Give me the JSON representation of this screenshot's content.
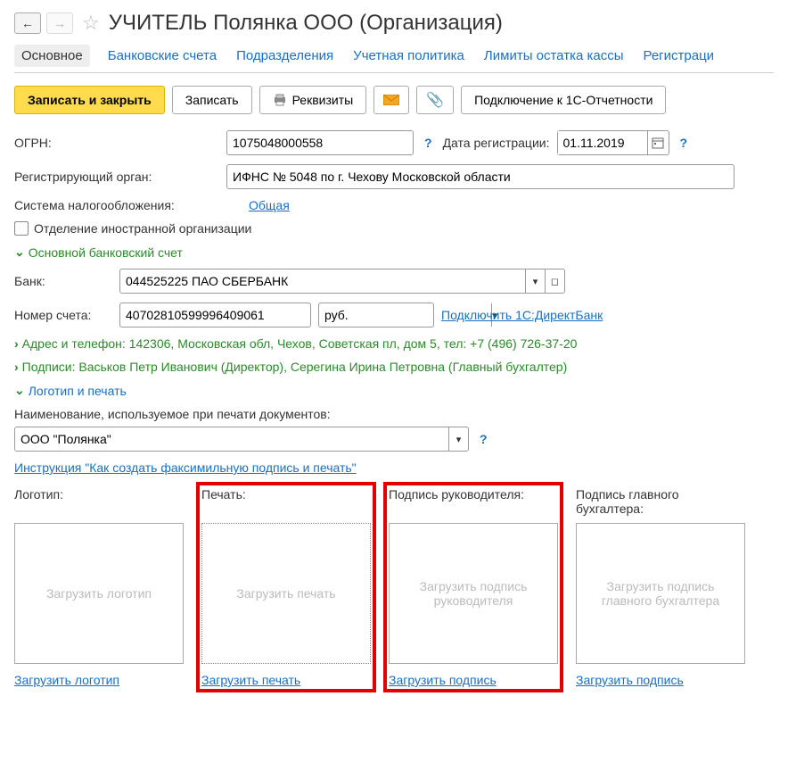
{
  "nav": {
    "back": "←",
    "forward": "→"
  },
  "title": "УЧИТЕЛЬ Полянка ООО (Организация)",
  "tabs": {
    "main": "Основное",
    "bank_accounts": "Банковские счета",
    "divisions": "Подразделения",
    "accounting_policy": "Учетная политика",
    "cash_limits": "Лимиты остатка кассы",
    "registrations": "Регистраци"
  },
  "toolbar": {
    "write_close": "Записать и закрыть",
    "write": "Записать",
    "requisites": "Реквизиты",
    "connect_reporting": "Подключение к 1С-Отчетности"
  },
  "fields": {
    "ogrn_label": "ОГРН:",
    "ogrn_value": "1075048000558",
    "reg_date_label": "Дата регистрации:",
    "reg_date_value": "01.11.2019",
    "reg_body_label": "Регистрирующий орган:",
    "reg_body_value": "ИФНС № 5048 по г. Чехову Московской области",
    "tax_system_label": "Система налогообложения:",
    "tax_system_value": "Общая",
    "foreign_branch": "Отделение иностранной организации"
  },
  "bank": {
    "header": "Основной банковский счет",
    "bank_label": "Банк:",
    "bank_value": "044525225 ПАО СБЕРБАНК",
    "account_label": "Номер счета:",
    "account_value": "40702810599996409061",
    "currency": "руб.",
    "direct_bank": "Подключить 1С:ДиректБанк"
  },
  "expanders": {
    "address": "Адрес и телефон: 142306, Московская обл, Чехов, Советская пл, дом 5, тел: +7 (496) 726-37-20",
    "signatures": "Подписи: Васьков Петр Иванович (Директор), Серегина Ирина Петровна (Главный бухгалтер)",
    "logo_stamp": "Логотип и печать"
  },
  "print_name": {
    "label": "Наименование, используемое при печати документов:",
    "value": "ООО \"Полянка\""
  },
  "instruction_link": "Инструкция \"Как создать факсимильную подпись и печать\"",
  "uploads": {
    "logo": {
      "label": "Логотип:",
      "placeholder": "Загрузить логотип",
      "link": "Загрузить логотип"
    },
    "stamp": {
      "label": "Печать:",
      "placeholder": "Загрузить печать",
      "link": "Загрузить печать"
    },
    "sig_head": {
      "label": "Подпись руководителя:",
      "placeholder": "Загрузить подпись руководителя",
      "link": "Загрузить подпись"
    },
    "sig_acc": {
      "label": "Подпись главного бухгалтера:",
      "placeholder": "Загрузить подпись главного бухгалтера",
      "link": "Загрузить подпись"
    }
  }
}
